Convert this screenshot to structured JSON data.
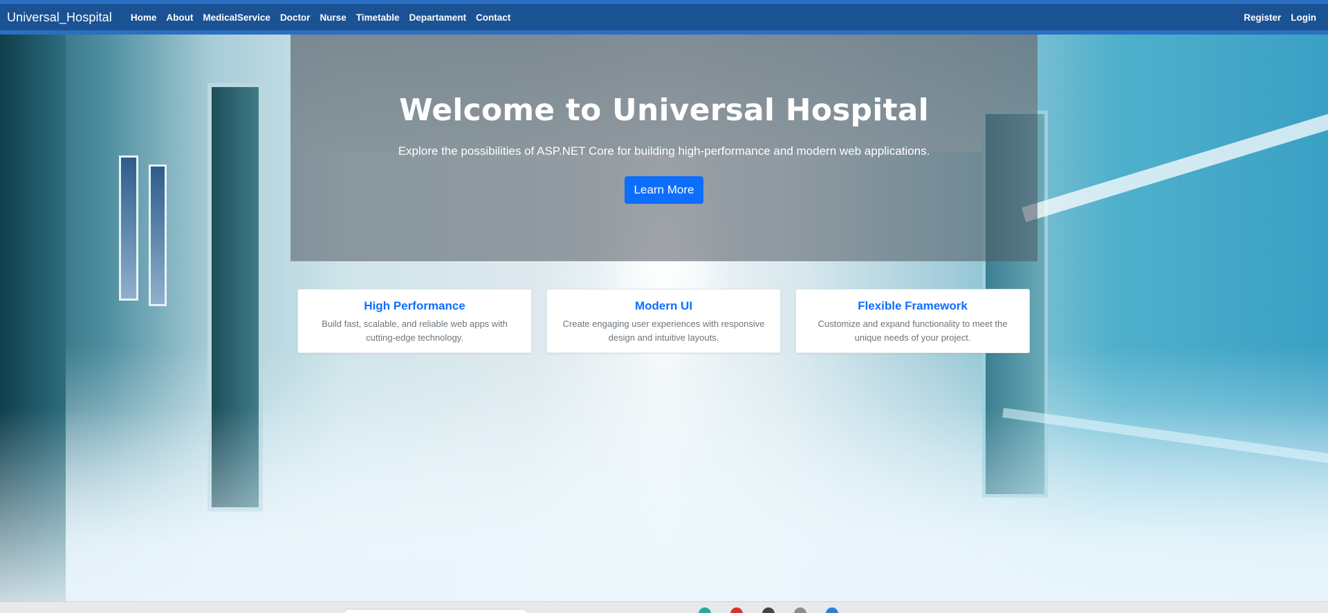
{
  "navbar": {
    "brand": "Universal_Hospital",
    "links": [
      "Home",
      "About",
      "MedicalService",
      "Doctor",
      "Nurse",
      "Timetable",
      "Departament",
      "Contact"
    ],
    "right_links": [
      "Register",
      "Login"
    ]
  },
  "hero": {
    "title": "Welcome to Universal Hospital",
    "subtitle_before": "Explore the possibilities of ",
    "subtitle_strong": "ASP.NET Core",
    "subtitle_after": " for building high-performance and modern web applications.",
    "button_label": "Learn More"
  },
  "cards": [
    {
      "title": "High Performance",
      "text": "Build fast, scalable, and reliable web apps with cutting-edge technology."
    },
    {
      "title": "Modern UI",
      "text": "Create engaging user experiences with responsive design and intuitive layouts."
    },
    {
      "title": "Flexible Framework",
      "text": "Customize and expand functionality to meet the unique needs of your project."
    }
  ],
  "colors": {
    "navbar": "#1a5294",
    "accent": "#0d6efd",
    "card_text": "#6c757d"
  },
  "icons": [
    "search-bar",
    "taskbar-app-icon"
  ]
}
